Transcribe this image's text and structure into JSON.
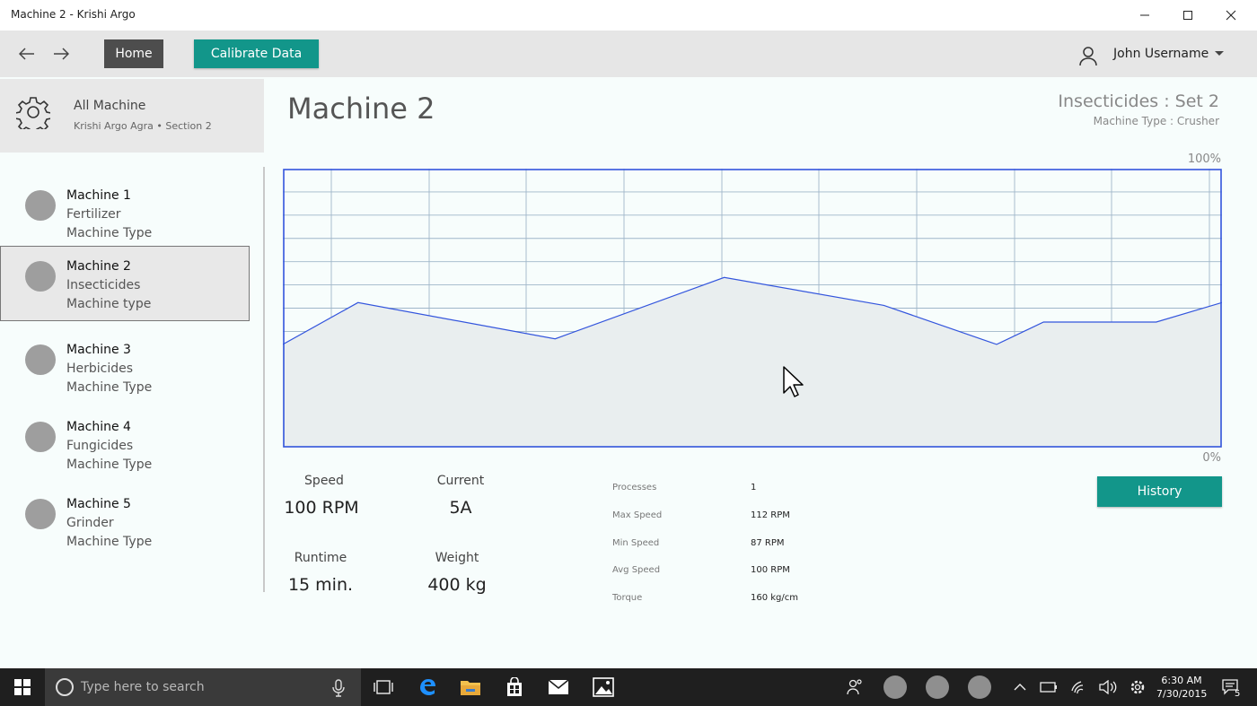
{
  "window": {
    "title": "Machine 2 - Krishi Argo"
  },
  "toolbar": {
    "home_label": "Home",
    "calibrate_label": "Calibrate Data",
    "user_name": "John Username"
  },
  "sidebar": {
    "header_title": "All Machine",
    "header_subtitle": "Krishi Argo Agra • Section 2",
    "items": [
      {
        "name": "Machine 1",
        "category": "Fertilizer",
        "type": "Machine Type",
        "selected": false
      },
      {
        "name": "Machine 2",
        "category": "Insecticides",
        "type": "Machine type",
        "selected": true
      },
      {
        "name": "Machine 3",
        "category": "Herbicides",
        "type": "Machine Type",
        "selected": false
      },
      {
        "name": "Machine 4",
        "category": "Fungicides",
        "type": "Machine Type",
        "selected": false
      },
      {
        "name": "Machine 5",
        "category": "Grinder",
        "type": "Machine Type",
        "selected": false
      }
    ]
  },
  "main": {
    "title": "Machine 2",
    "set_title": "Insecticides : Set 2",
    "machine_type": "Machine Type : Crusher",
    "chart_top_label": "100%",
    "chart_bottom_label": "0%",
    "stats": {
      "speed_label": "Speed",
      "speed_value": "100 RPM",
      "current_label": "Current",
      "current_value": "5A",
      "runtime_label": "Runtime",
      "runtime_value": "15 min.",
      "weight_label": "Weight",
      "weight_value": "400 kg"
    },
    "details": [
      {
        "label": "Processes",
        "value": "1"
      },
      {
        "label": "Max Speed",
        "value": "112 RPM"
      },
      {
        "label": "Min Speed",
        "value": "87 RPM"
      },
      {
        "label": "Avg Speed",
        "value": "100 RPM"
      },
      {
        "label": "Torque",
        "value": "160 kg/cm"
      }
    ],
    "history_label": "History"
  },
  "chart_data": {
    "type": "area",
    "x": [
      0,
      8,
      29,
      47,
      64,
      76,
      81,
      87,
      93,
      100
    ],
    "values": [
      37,
      52,
      39,
      61,
      51,
      37,
      45,
      45,
      45,
      52
    ],
    "ylim": [
      0,
      100
    ],
    "grid": true,
    "line_color": "#3355dd",
    "fill_color": "#e9eeef"
  },
  "taskbar": {
    "search_placeholder": "Type here to search",
    "time": "6:30 AM",
    "date": "7/30/2015",
    "notification_count": "5"
  },
  "colors": {
    "accent": "#12968a",
    "home_button": "#4d4d4d",
    "background": "#f7fdfc"
  }
}
